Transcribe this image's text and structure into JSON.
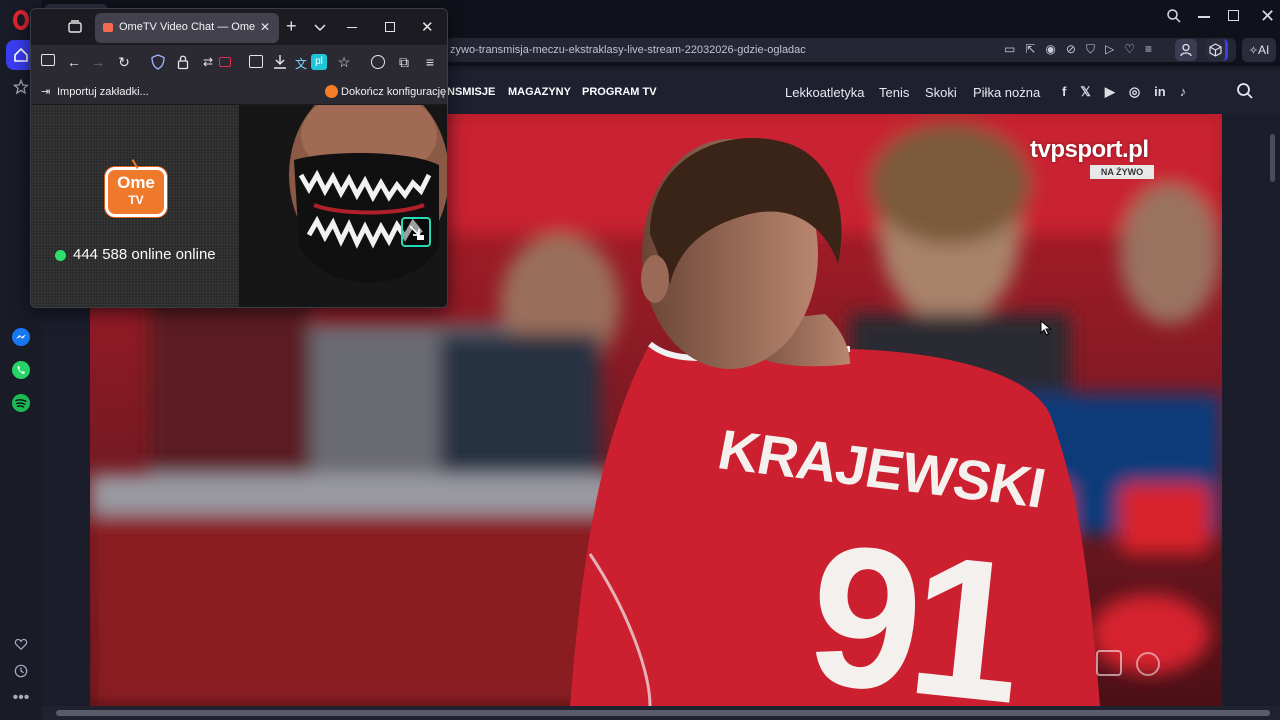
{
  "browser": {
    "url_fragment": "zywo-transmisja-meczu-ekstraklasy-live-stream-22032026-gdzie-ogladac",
    "ai_label": "AI"
  },
  "site_nav": {
    "left_items": [
      "NSMISJE",
      "MAGAZYNY",
      "PROGRAM TV"
    ],
    "right_items": [
      "Lekkoatletyka",
      "Tenis",
      "Skoki",
      "Piłka nożna"
    ]
  },
  "video": {
    "watermark": "tvpsport.pl",
    "live_badge": "NA ŻYWO",
    "player_name": "KRAJEWSKI",
    "player_number": "91"
  },
  "popup": {
    "tab_title": "OmeTV Video Chat — Omegle A",
    "translate_badge": "pl",
    "bookmark_import": "Importuj zakładki...",
    "bookmark_finish": "Dokończ konfigurację",
    "logo_top": "Ome",
    "logo_bottom": "TV",
    "online_count": "444 588 online online"
  },
  "colors": {
    "live_green": "#2ee06b",
    "ome_orange": "#f07a2b",
    "jersey_red": "#c8202c"
  }
}
